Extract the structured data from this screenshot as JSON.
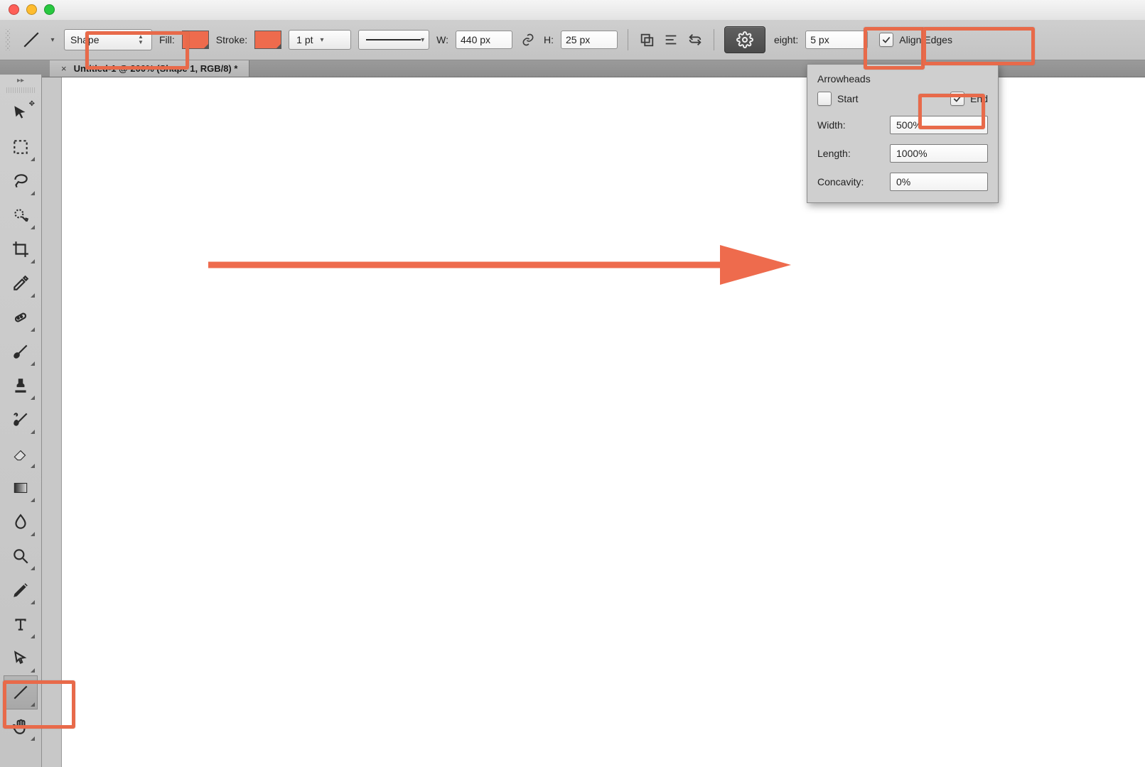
{
  "colors": {
    "accent": "#ee6b4d",
    "gear_bg": "#555555"
  },
  "options": {
    "shape_mode": "Shape",
    "fill_label": "Fill:",
    "stroke_label": "Stroke:",
    "stroke_weight_pt": "1 pt",
    "w_label": "W:",
    "w_value": "440 px",
    "h_label": "H:",
    "h_value": "25 px",
    "weight_label": "eight:",
    "weight_value": "5 px",
    "align_edges_label": "Align Edges",
    "align_edges_checked": true,
    "fill_swatch": "#ee6b4d",
    "stroke_swatch": "#ee6b4d"
  },
  "popover": {
    "title": "Arrowheads",
    "start_label": "Start",
    "start_checked": false,
    "end_label": "End",
    "end_checked": true,
    "width_label": "Width:",
    "width_value": "500%",
    "length_label": "Length:",
    "length_value": "1000%",
    "concavity_label": "Concavity:",
    "concavity_value": "0%"
  },
  "doc_tab": {
    "title": "Untitled-1 @ 200% (Shape 1, RGB/8) *"
  },
  "tools": [
    "move",
    "marquee",
    "lasso",
    "quick-select",
    "crop",
    "eyedropper",
    "heal",
    "brush",
    "stamp",
    "history-brush",
    "eraser",
    "gradient",
    "blur",
    "zoom",
    "pen",
    "type",
    "direct-select",
    "line",
    "hand"
  ]
}
